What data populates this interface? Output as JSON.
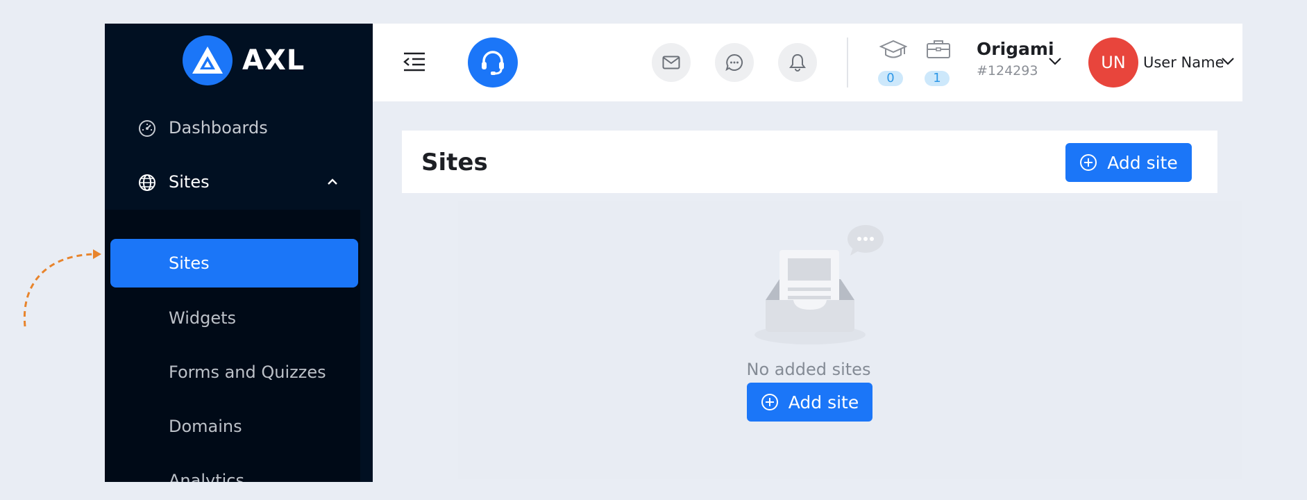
{
  "brand": {
    "name": "AXL"
  },
  "sidebar": {
    "items": [
      {
        "label": "Dashboards",
        "icon": "speedometer-icon"
      },
      {
        "label": "Sites",
        "icon": "globe-icon",
        "expanded": true
      }
    ],
    "submenu": [
      {
        "label": "Sites",
        "active": true
      },
      {
        "label": "Widgets"
      },
      {
        "label": "Forms and Quizzes"
      },
      {
        "label": "Domains"
      },
      {
        "label": "Analytics"
      }
    ]
  },
  "header": {
    "counters": [
      {
        "icon": "graduation-cap-icon",
        "count": "0"
      },
      {
        "icon": "briefcase-icon",
        "count": "1"
      }
    ],
    "org": {
      "name": "Origami",
      "id": "#124293"
    },
    "user": {
      "initials": "UN",
      "name": "User Name"
    }
  },
  "page": {
    "title": "Sites",
    "add_button_label": "Add site",
    "empty_text": "No added sites",
    "empty_button_label": "Add site"
  },
  "colors": {
    "accent": "#1b76f8",
    "sidebar_bg": "#011022",
    "avatar": "#e8453c",
    "annotation": "#e8842c"
  }
}
